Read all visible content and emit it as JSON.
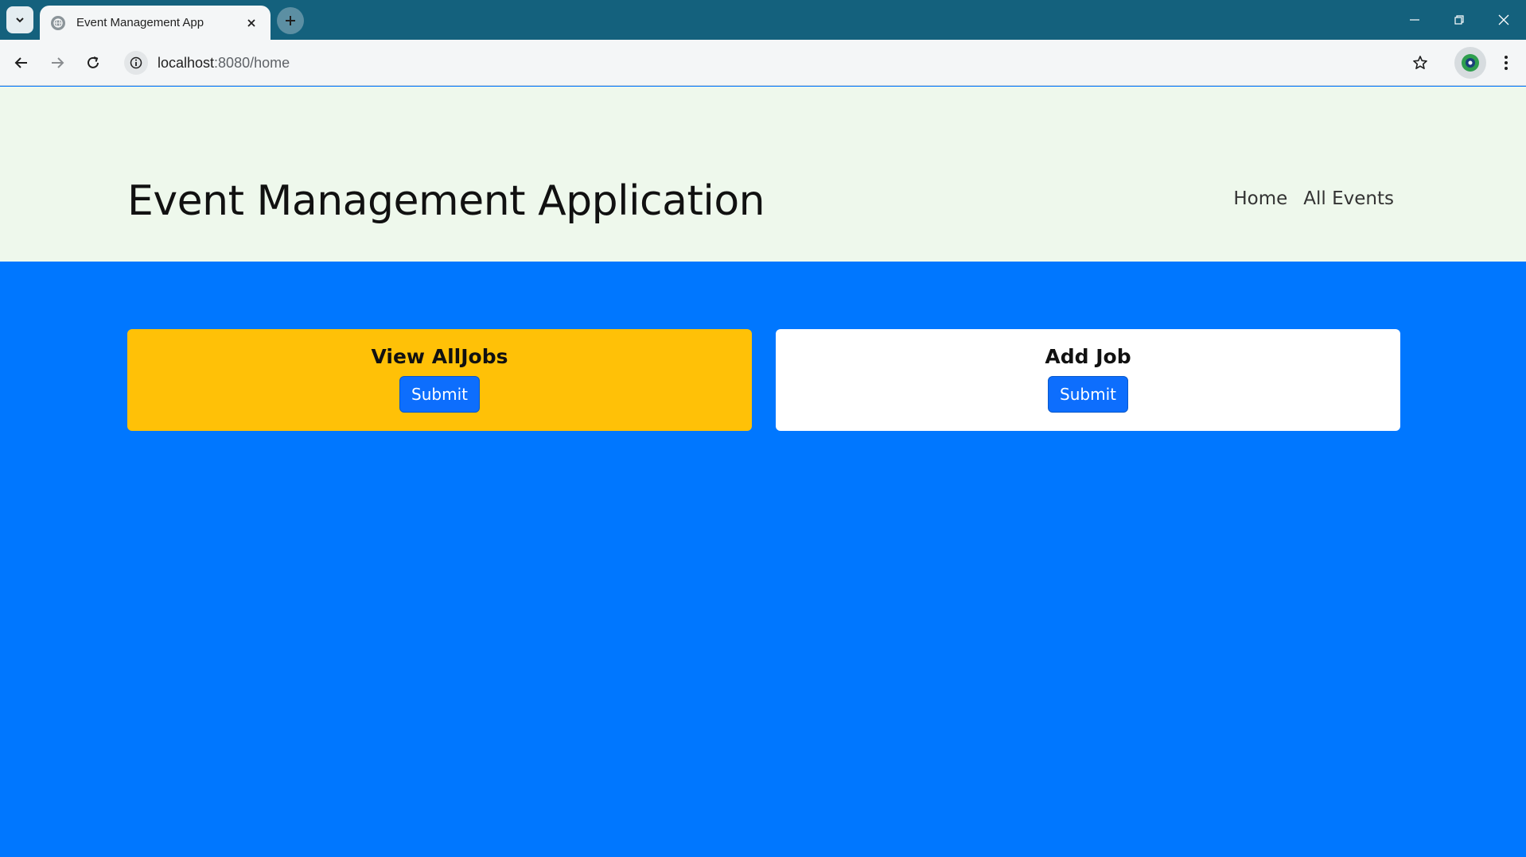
{
  "browser": {
    "tab_title": "Event Management App",
    "url_host": "localhost",
    "url_path": ":8080/home",
    "icons": {
      "tab_menu": "chevron-down-icon",
      "favicon": "globe-icon",
      "tab_close": "close-icon",
      "new_tab": "plus-icon",
      "back": "arrow-left-icon",
      "forward": "arrow-right-icon",
      "reload": "reload-icon",
      "site_info": "info-icon",
      "bookmark": "star-icon",
      "profile": "profile-avatar-icon",
      "menu": "kebab-menu-icon",
      "minimize": "minimize-icon",
      "restore": "restore-icon",
      "close_window": "close-icon"
    },
    "colors": {
      "tabbar": "#14617d",
      "toolbar": "#f4f6f7"
    }
  },
  "header": {
    "title": "Event Management Application",
    "nav": [
      {
        "label": "Home"
      },
      {
        "label": "All Events"
      }
    ],
    "background": "#eef8ec"
  },
  "main": {
    "background": "#0077ff",
    "cards": [
      {
        "title": "View AllJobs",
        "button_label": "Submit",
        "color": "#ffc107"
      },
      {
        "title": "Add Job",
        "button_label": "Submit",
        "color": "#ffffff"
      }
    ],
    "button_color": "#0d6efd"
  }
}
